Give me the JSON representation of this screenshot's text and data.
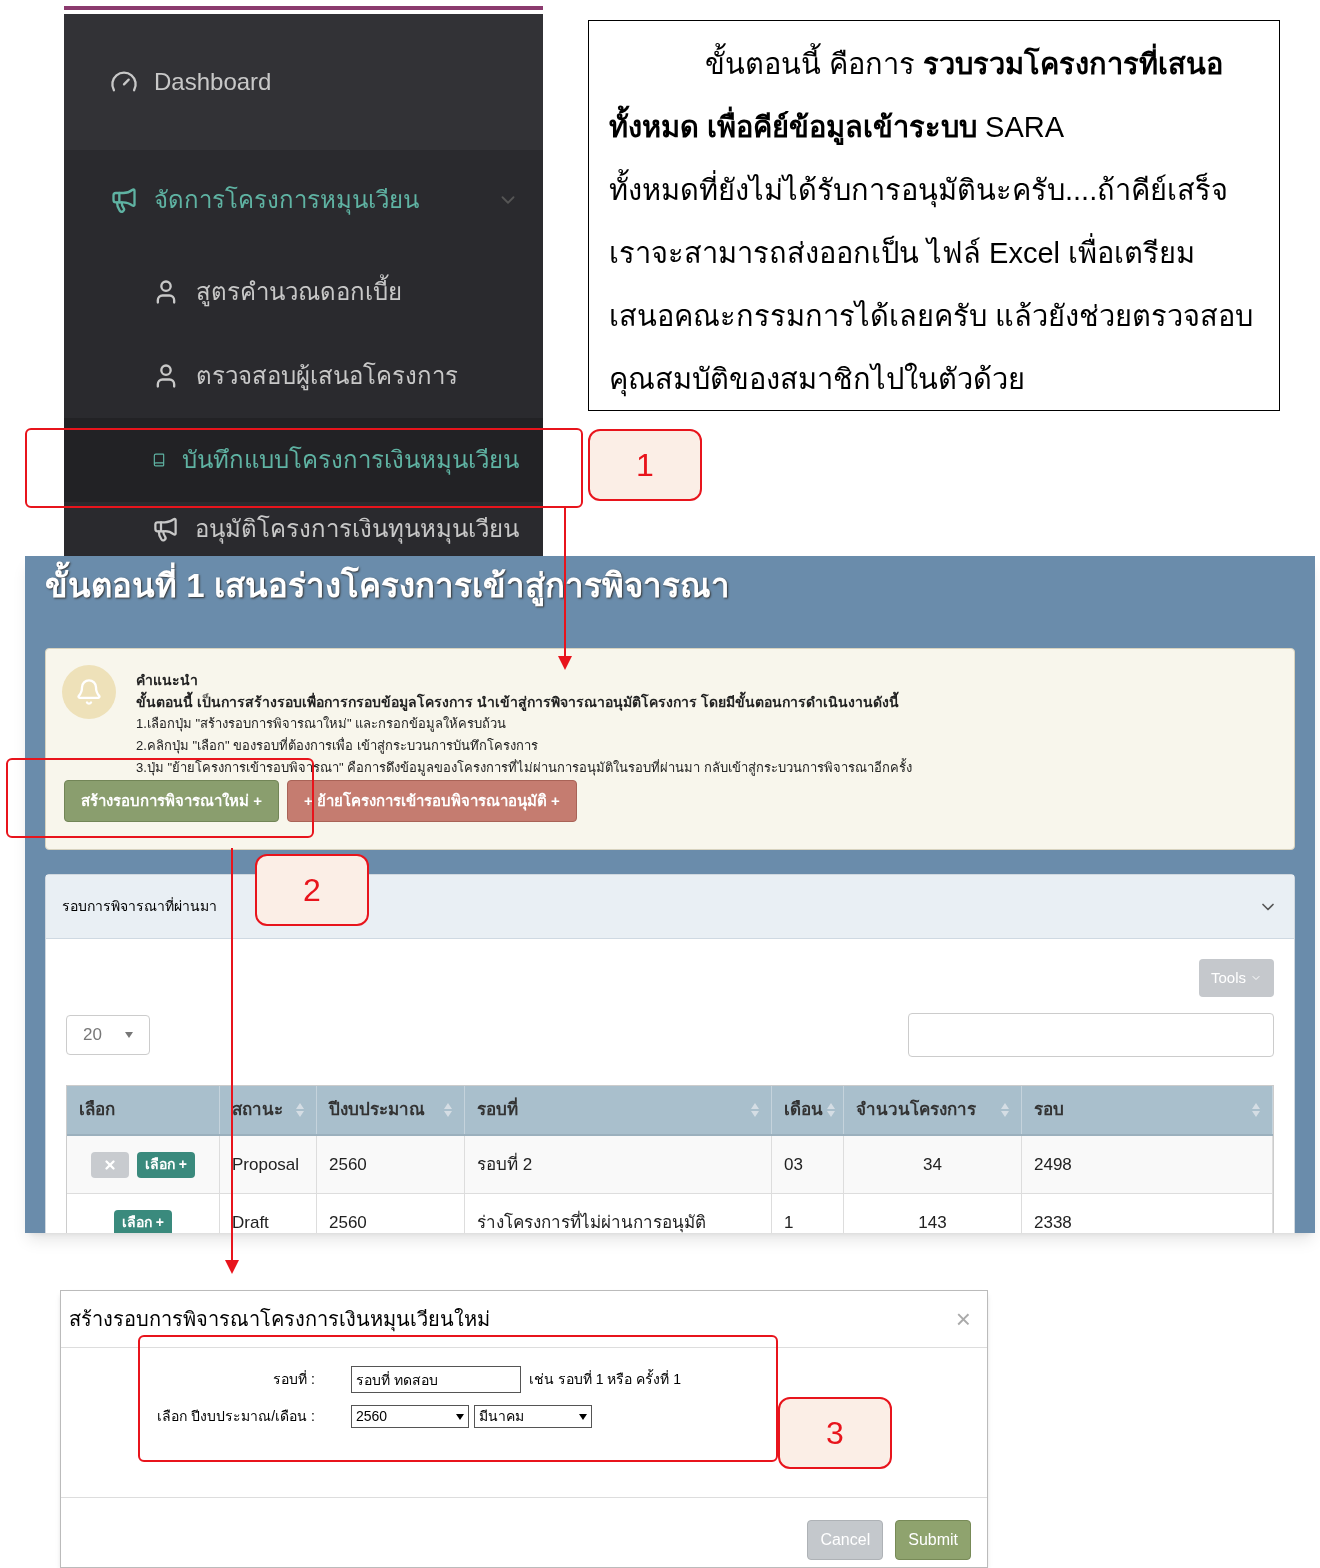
{
  "note": {
    "paragraphs": [
      "ขั้นตอนนี้ คือการ **รวบรวมโครงการที่เสนอทั้งหมด เพื่อคีย์ข้อมูลเข้าระบบ** SARA",
      "ทั้งหมดที่ยังไม่ได้รับการอนุมัตินะครับ....ถ้าคีย์เสร็จเราจะสามารถส่งออกเป็น ไฟล์ Excel เพื่อเตรียมเสนอคณะกรรมการได้เลยครับ แล้วยังช่วยตรวจสอบคุณสมบัติของสมาชิกไปในตัวด้วย"
    ]
  },
  "sidebar": {
    "items": [
      {
        "kind": "top",
        "label": "Dashboard",
        "selected": false
      },
      {
        "kind": "group",
        "label": "จัดการโครงการหมุนเวียน",
        "selected": true,
        "expanded": true
      },
      {
        "kind": "sub",
        "label": "สูตรคำนวณดอกเบี้ย",
        "selected": false
      },
      {
        "kind": "sub",
        "label": "ตรวจสอบผู้เสนอโครงการ",
        "selected": false
      },
      {
        "kind": "sub",
        "label": "บันทึกแบบโครงการเงินหมุนเวียน",
        "selected": true
      },
      {
        "kind": "sub",
        "label": "อนุมัติโครงการเงินทุนหมุนเวียน",
        "selected": false
      }
    ]
  },
  "callouts": [
    "1",
    "2",
    "3"
  ],
  "page": {
    "title": "ขั้นตอนที่ 1 เสนอร่างโครงการเข้าสู่การพิจารณา",
    "hint": {
      "heading": "คำแนะนำ",
      "intro": "ขั้นตอนนี้ เป็นการสร้างรอบเพื่อการกรอบข้อมูลโครงการ นำเข้าสู่การพิจารณาอนุมัติโครงการ โดยมีขั้นตอนการดำเนินงานดังนี้",
      "steps": [
        "1.เลือกปุ่ม \"สร้างรอบการพิจารณาใหม่\" และกรอกข้อมูลให้ครบถ้วน",
        "2.คลิกปุ่ม \"เลือก\" ของรอบที่ต้องการเพื่อ เข้าสู่กระบวนการบันทึกโครงการ",
        "3.ปุ่ม \"ย้ายโครงการเข้ารอบพิจารณา\" คือการดึงข้อมูลของโครงการที่ไม่ผ่านการอนุมัติในรอบที่ผ่านมา กลับเข้าสู่กระบวนการพิจารณาอีกครั้ง"
      ]
    },
    "buttons": [
      {
        "kind": "create",
        "label": "สร้างรอบการพิจารณาใหม่ +"
      },
      {
        "kind": "move",
        "label": "+ ย้ายโครงการเข้ารอบพิจารณาอนุมัติ +"
      }
    ],
    "panel": {
      "title": "รอบการพิจารณาที่ผ่านมา",
      "expanded": true,
      "tools": "Tools",
      "page_size": "20",
      "columns": [
        {
          "label": "เลือก",
          "sortable": false
        },
        {
          "label": "สถานะ",
          "sortable": true
        },
        {
          "label": "ปีงบประมาณ",
          "sortable": true
        },
        {
          "label": "รอบที่",
          "sortable": true
        },
        {
          "label": "เดือน",
          "sortable": true
        },
        {
          "label": "จำนวนโครงการ",
          "sortable": true
        },
        {
          "label": "รอบ",
          "sortable": true
        }
      ],
      "rows": [
        {
          "deletable": true,
          "cells": [
            "เลือก +",
            "Proposal",
            "2560",
            "รอบที่ 2",
            "03",
            "34",
            "2498"
          ]
        },
        {
          "deletable": false,
          "cells": [
            "เลือก +",
            "Draft",
            "2560",
            "ร่างโครงการที่ไม่ผ่านการอนุมัติ",
            "1",
            "143",
            "2338"
          ]
        }
      ]
    }
  },
  "dialog": {
    "title": "สร้างรอบการพิจารณาโครงการเงินหมุนเวียนใหม่",
    "close": "×",
    "round": {
      "label": "รอบที่ :",
      "value": "รอบที่ ทดสอบ",
      "example": "เช่น รอบที่ 1 หรือ ครั้งที่ 1"
    },
    "period": {
      "label": "เลือก ปีงบประมาณ/เดือน :",
      "year": "2560",
      "month": "มีนาคม"
    },
    "buttons": [
      {
        "kind": "cancel",
        "label": "Cancel"
      },
      {
        "kind": "submit",
        "label": "Submit"
      }
    ]
  }
}
